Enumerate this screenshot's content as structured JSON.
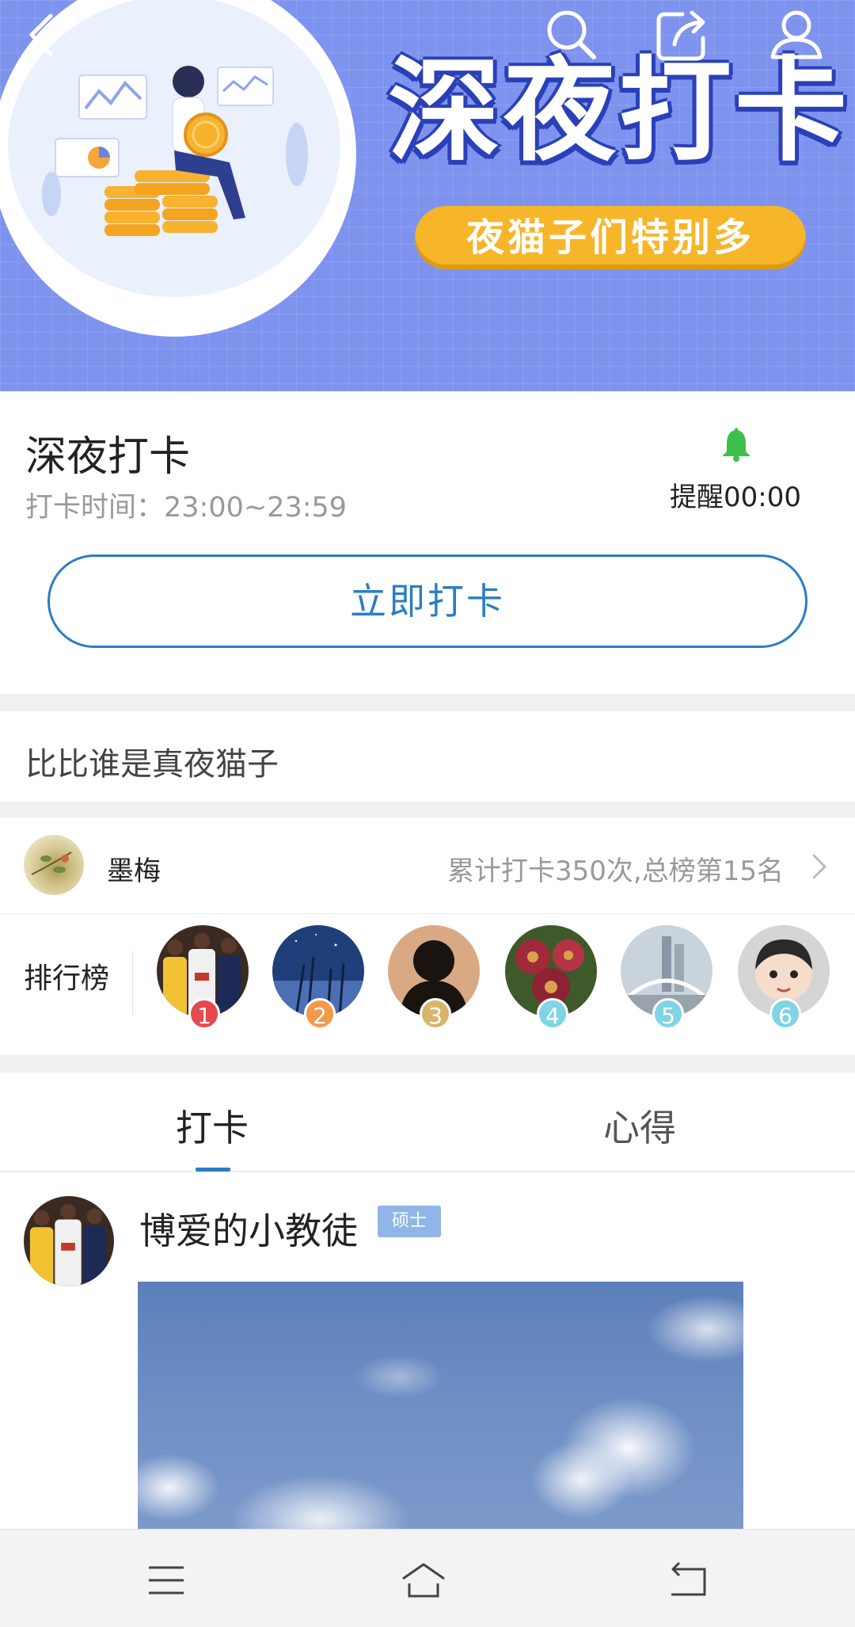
{
  "banner": {
    "title": "深夜打卡",
    "subtitle": "夜猫子们特别多"
  },
  "topbar": {
    "icons": [
      "back-icon",
      "search-icon",
      "share-icon",
      "profile-icon"
    ]
  },
  "info": {
    "title": "深夜打卡",
    "time_label": "打卡时间：23:00~23:59",
    "remind_label": "提醒00:00",
    "remind_color": "#3cbf4a",
    "checkin_button": "立即打卡",
    "accent": "#2a7dc6"
  },
  "compete": {
    "text": "比比谁是真夜猫子"
  },
  "current_user": {
    "name": "墨梅",
    "stats": "累计打卡350次,总榜第15名"
  },
  "ranking": {
    "label": "排行榜",
    "items": [
      {
        "rank": "1",
        "badge_color": "#e5484d"
      },
      {
        "rank": "2",
        "badge_color": "#f29a4a"
      },
      {
        "rank": "3",
        "badge_color": "#d9b56a"
      },
      {
        "rank": "4",
        "badge_color": "#7fd4e6"
      },
      {
        "rank": "5",
        "badge_color": "#7fd4e6"
      },
      {
        "rank": "6",
        "badge_color": "#7fd4e6"
      }
    ]
  },
  "tabs": [
    {
      "label": "打卡",
      "active": true
    },
    {
      "label": "心得",
      "active": false
    }
  ],
  "post": {
    "author": "博爱的小教徒",
    "badge": "硕士"
  },
  "navbar": {
    "icons": [
      "menu-icon",
      "home-icon",
      "return-icon"
    ]
  }
}
